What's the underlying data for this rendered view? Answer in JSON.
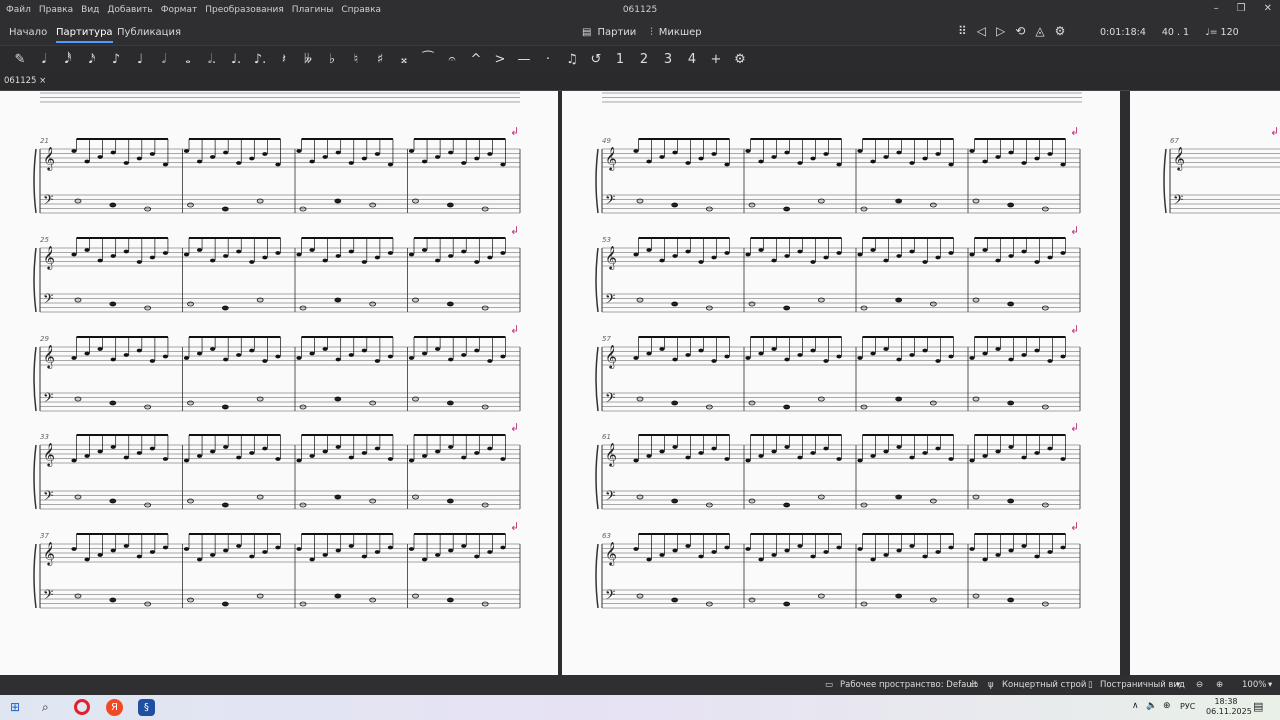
{
  "window": {
    "menu": [
      "Файл",
      "Правка",
      "Вид",
      "Добавить",
      "Формат",
      "Преобразования",
      "Плагины",
      "Справка"
    ],
    "title": "061125",
    "min_icon": "minimize-icon",
    "max_icon": "restore-icon",
    "close_icon": "close-icon"
  },
  "nav": {
    "tabs": [
      {
        "label": "Начало"
      },
      {
        "label": "Партитура",
        "active": true
      },
      {
        "label": "Публикация"
      }
    ],
    "parts_label": "Партии",
    "mixer_label": "Микшер",
    "time": "0:01:18:4",
    "position": "40 . 1",
    "tempo": "= 120"
  },
  "toolbar": {
    "glyphs": [
      "✎",
      "𝅘𝅥",
      "𝅘𝅥𝅰",
      "𝅘𝅥𝅯",
      "♪",
      "♩",
      "𝅗𝅥",
      "𝅝",
      "𝅗𝅥.",
      "♩.",
      "♪.",
      "𝄽",
      "𝄫",
      "♭",
      "♮",
      "♯",
      "𝄪",
      "⁀",
      "𝄐",
      "^",
      ">",
      "—",
      "·",
      "♫",
      "↺",
      "1",
      "2",
      "3",
      "4",
      "+",
      "⚙"
    ]
  },
  "document_tab": {
    "name": "061125",
    "close": "×"
  },
  "score": {
    "accent": "#c0387a",
    "left_page_systems": [
      "21",
      "25",
      "29",
      "33",
      "37"
    ],
    "right_page_systems": [
      "49",
      "53",
      "57",
      "61",
      "63"
    ],
    "third_page_systems": [
      "67"
    ]
  },
  "statusbar": {
    "workspace": "Рабочее пространство: Default",
    "concert_pitch": "Концертный строй",
    "view_mode": "Постраничный вид",
    "zoom": "100%"
  },
  "taskbar": {
    "lang": "РУС",
    "time": "18:38",
    "date": "06.11.2025"
  }
}
